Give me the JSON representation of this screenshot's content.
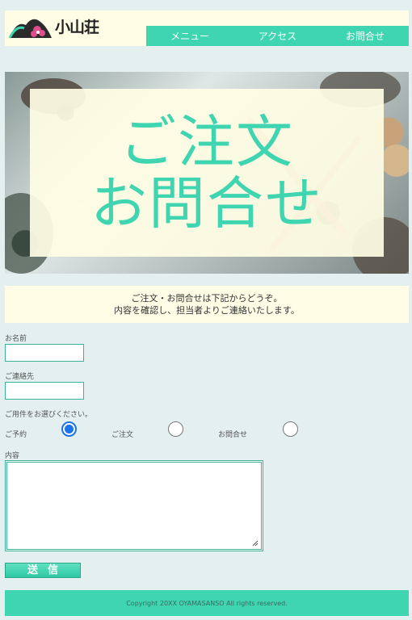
{
  "header": {
    "logo_text": "小山荘",
    "nav": [
      "メニュー",
      "アクセス",
      "お問合せ"
    ]
  },
  "hero": {
    "line1": "ご注文",
    "line2": "お問合せ"
  },
  "intro": {
    "line1": "ご注文・お問合せは下記からどうぞ。",
    "line2": "内容を確認し、担当者よりご連絡いたします。"
  },
  "form": {
    "name_label": "お名前",
    "contact_label": "ご連絡先",
    "purpose_label": "ご用件をお選びください。",
    "options": [
      "ご予約",
      "ご注文",
      "お問合せ"
    ],
    "selected_option": "ご予約",
    "content_label": "内容",
    "submit_label": "送信"
  },
  "footer": {
    "copyright": "Copyright 20XX OYAMASANSO All rights reserved."
  },
  "colors": {
    "accent": "#3fd5b0",
    "background": "#e3f0ef",
    "panel": "#fffde6"
  }
}
